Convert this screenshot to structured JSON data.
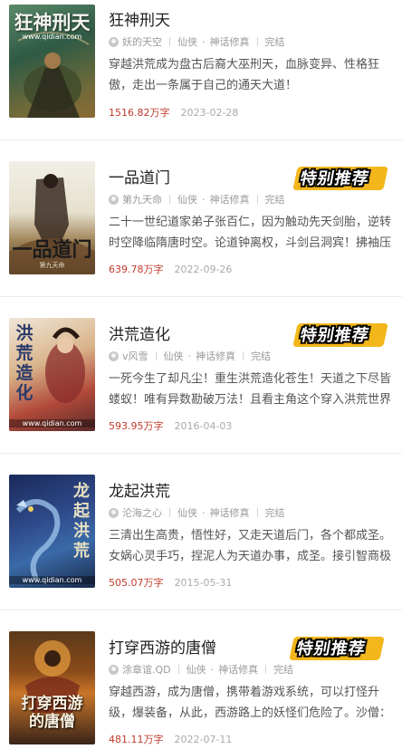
{
  "badge_label": "特别推荐",
  "books": [
    {
      "title": "狂神刑天",
      "author": "妖的天空",
      "category": "仙侠",
      "subcategory": "神话修真",
      "status": "完结",
      "description": "穿越洪荒成为盘古后裔大巫刑天，血脉变异、性格狂傲，走出一条属于自己的通天大道！",
      "word_count": "1516.82万字",
      "date": "2023-02-28",
      "featured": false,
      "cover": {
        "title": "狂神刑天",
        "subtitle": "www.qidian.com"
      }
    },
    {
      "title": "一品道门",
      "author": "第九天命",
      "category": "仙侠",
      "subcategory": "神话修真",
      "status": "完结",
      "description": "二十一世纪道家弟子张百仁，因为触动先天剑胎，逆转时空降临隋唐时空。论道钟离权，斗剑吕洞宾！拂袖压",
      "word_count": "639.78万字",
      "date": "2022-09-26",
      "featured": true,
      "cover": {
        "title": "一品道门",
        "subtitle": "第九天命"
      }
    },
    {
      "title": "洪荒造化",
      "author": "v风雪",
      "category": "仙侠",
      "subcategory": "神话修真",
      "status": "完结",
      "description": "一死今生了却凡尘！重生洪荒造化苍生！天道之下尽皆蝼蚁！唯有异数勘破万法！且看主角这个穿入洪荒世界",
      "word_count": "593.95万字",
      "date": "2016-04-03",
      "featured": true,
      "cover": {
        "title": "洪荒造化",
        "subtitle": "www.qidian.com"
      }
    },
    {
      "title": "龙起洪荒",
      "author": "沦海之心",
      "category": "仙侠",
      "subcategory": "神话修真",
      "status": "完结",
      "description": "三清出生高贵，悟性好，又走天道后门，各个都成圣。女娲心灵手巧，捏泥人为天道办事，成圣。接引智商极",
      "word_count": "505.07万字",
      "date": "2015-05-31",
      "featured": false,
      "cover": {
        "title": "龙起洪荒",
        "subtitle": "www.qidian.com"
      }
    },
    {
      "title": "打穿西游的唐僧",
      "author": "涂章谊.QD",
      "category": "仙侠",
      "subcategory": "神话修真",
      "status": "完结",
      "description": "穿越西游，成为唐僧，携带着游戏系统，可以打怪升级，爆装备，从此，西游路上的妖怪们危险了。沙僧：",
      "word_count": "481.11万字",
      "date": "2022-07-11",
      "featured": true,
      "cover": {
        "title": "打穿西游的唐僧",
        "subtitle": ""
      }
    }
  ]
}
